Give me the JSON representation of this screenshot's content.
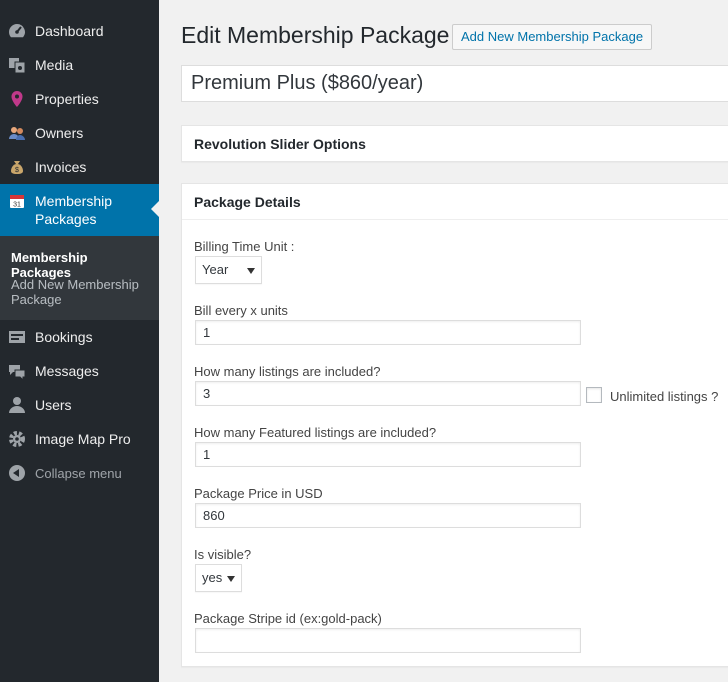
{
  "sidebar": {
    "items": [
      {
        "label": "Dashboard",
        "icon": "dashboard-icon"
      },
      {
        "label": "Media",
        "icon": "media-icon"
      },
      {
        "label": "Properties",
        "icon": "map-pin-icon"
      },
      {
        "label": "Owners",
        "icon": "users-group-icon"
      },
      {
        "label": "Invoices",
        "icon": "money-bag-icon"
      },
      {
        "label": "Membership Packages",
        "icon": "calendar-icon"
      },
      {
        "label": "Bookings",
        "icon": "bookings-icon"
      },
      {
        "label": "Messages",
        "icon": "messages-icon"
      },
      {
        "label": "Users",
        "icon": "user-icon"
      },
      {
        "label": "Image Map Pro",
        "icon": "gear-icon"
      }
    ],
    "submenu": [
      {
        "label": "Membership Packages"
      },
      {
        "label": "Add New Membership Package"
      }
    ],
    "collapse_label": "Collapse menu",
    "calendar_day": "31"
  },
  "page": {
    "title": "Edit Membership Package",
    "add_new_label": "Add New Membership Package",
    "post_title": "Premium Plus ($860/year)"
  },
  "boxes": {
    "revolution": {
      "title": "Revolution Slider Options"
    },
    "package": {
      "title": "Package Details"
    }
  },
  "fields": {
    "billing_unit": {
      "label": "Billing Time Unit :",
      "value": "Year"
    },
    "bill_every": {
      "label": "Bill every x units",
      "value": "1"
    },
    "listings": {
      "label": "How many listings are included?",
      "value": "3",
      "unlimited_label": "Unlimited listings ?"
    },
    "featured": {
      "label": "How many Featured listings are included?",
      "value": "1"
    },
    "price": {
      "label": "Package Price in USD",
      "value": "860"
    },
    "visible": {
      "label": "Is visible?",
      "value": "yes"
    },
    "stripe": {
      "label": "Package Stripe id (ex:gold-pack)",
      "value": ""
    }
  },
  "colors": {
    "sidebar_bg": "#23282d",
    "active_bg": "#0073aa",
    "link": "#0073aa",
    "page_bg": "#f1f1f1"
  }
}
